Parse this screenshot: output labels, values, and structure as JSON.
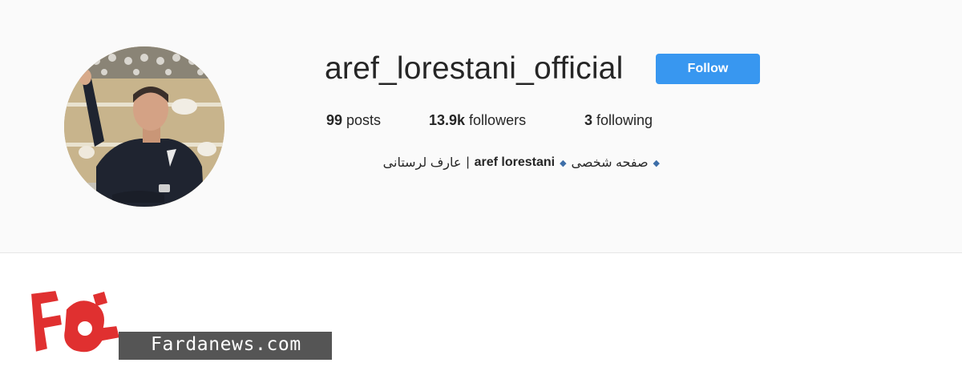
{
  "profile": {
    "username": "aref_lorestani_official",
    "follow_label": "Follow",
    "accent_color": "#3897f0",
    "stats": {
      "posts_count": "99",
      "posts_label": "posts",
      "followers_count": "13.9k",
      "followers_label": "followers",
      "following_count": "3",
      "following_label": "following"
    },
    "bio": {
      "persian_name": "عارف لرستانی",
      "separator": "|",
      "english_name": "aref lorestani",
      "page_label": "صفحه شخصی"
    }
  },
  "watermark": {
    "logo_text": "فردا",
    "site": "Fardanews.com",
    "logo_color": "#e03030"
  }
}
